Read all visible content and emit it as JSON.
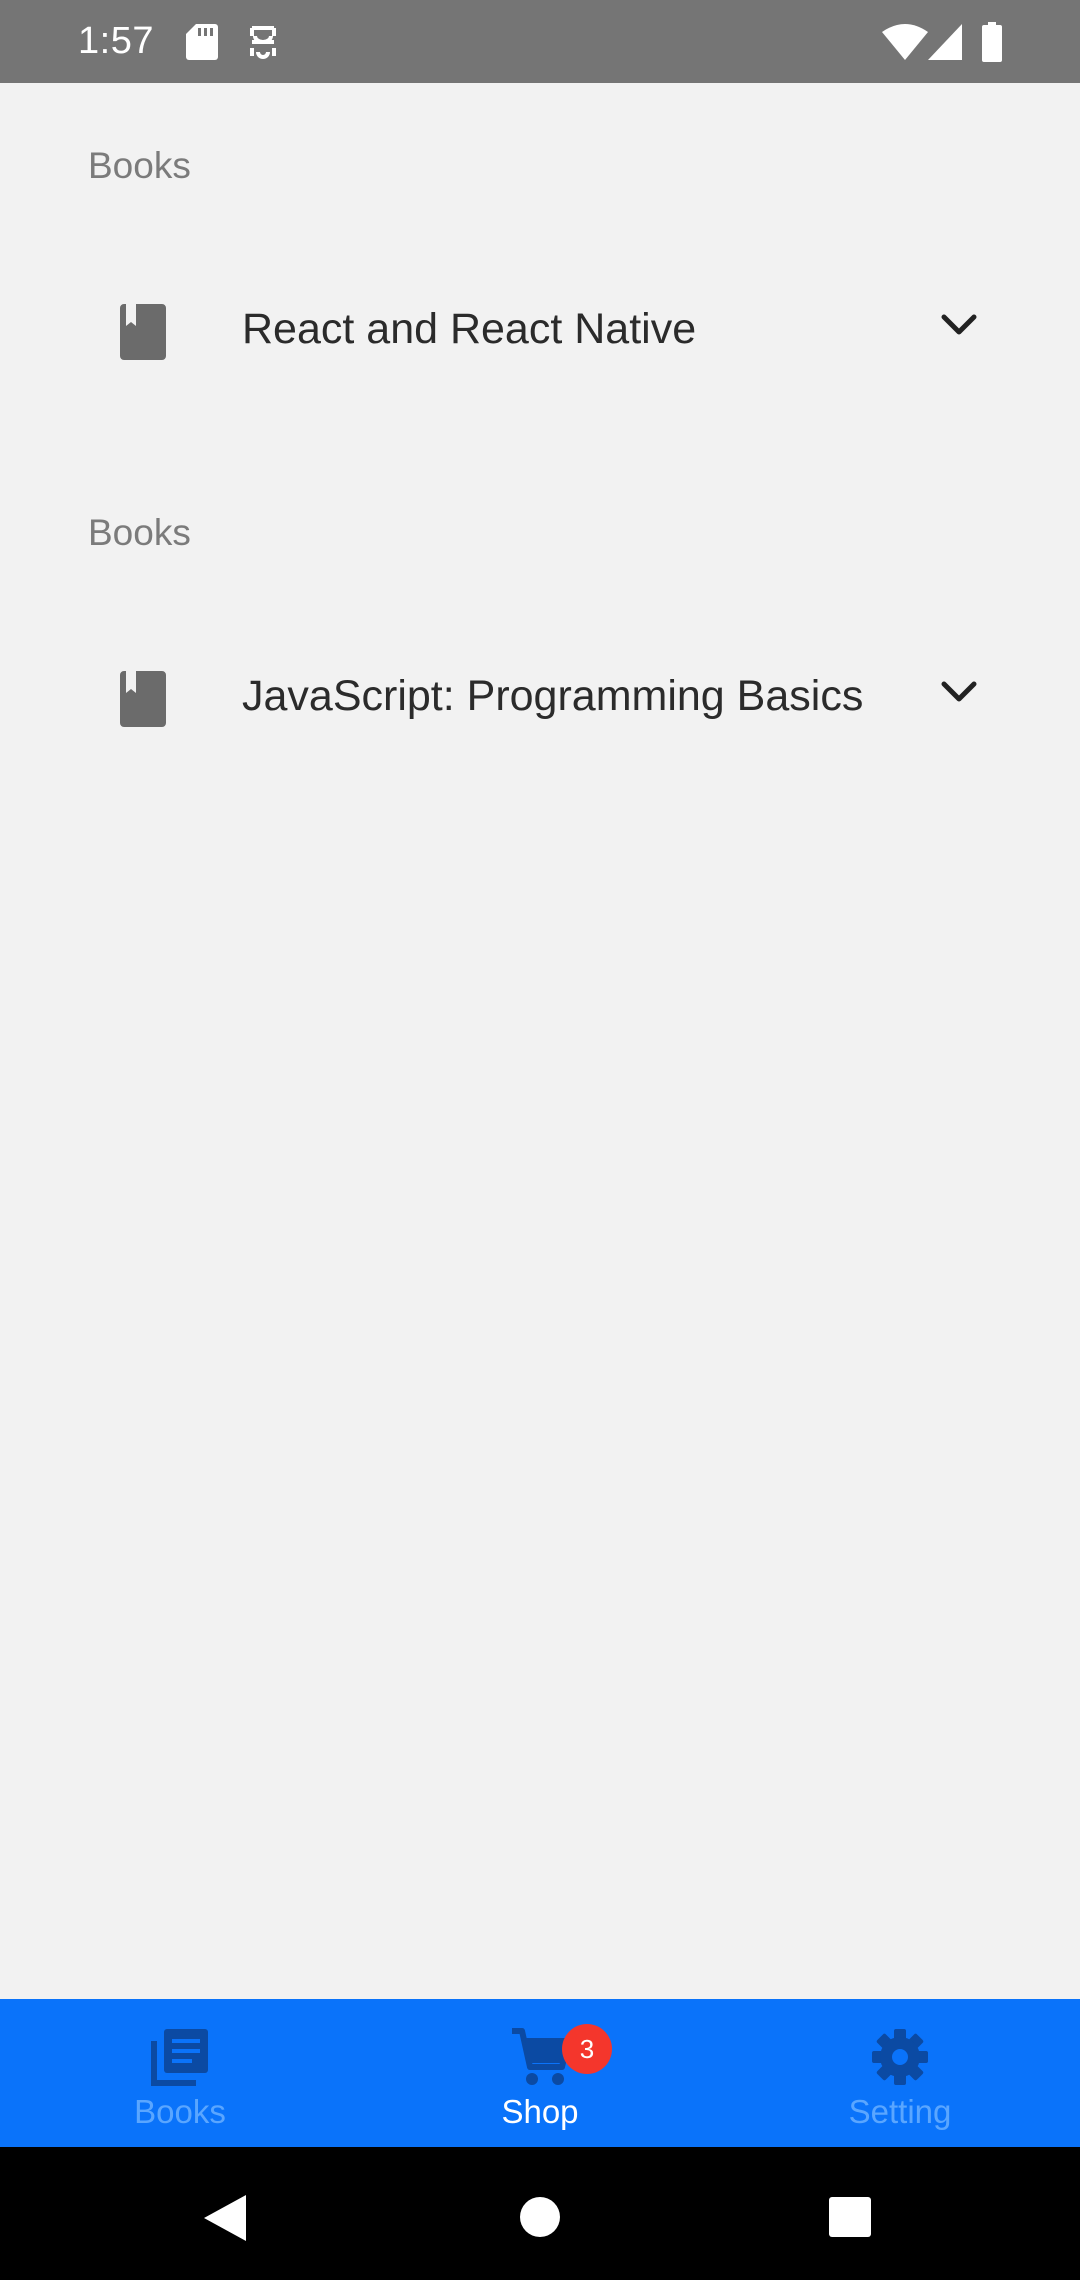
{
  "status_bar": {
    "time": "1:57",
    "icons": [
      "sd-card-icon",
      "debug-icon",
      "wifi-icon",
      "signal-icon",
      "battery-icon"
    ]
  },
  "sections": [
    {
      "header": "Books",
      "book": {
        "title": "React and React Native",
        "icon": "book-icon"
      }
    },
    {
      "header": "Books",
      "book": {
        "title": "JavaScript: Programming Basics",
        "icon": "book-icon"
      }
    }
  ],
  "tab_bar": {
    "tabs": [
      {
        "label": "Books",
        "icon": "library-books-icon",
        "active": false
      },
      {
        "label": "Shop",
        "icon": "cart-icon",
        "active": true
      },
      {
        "label": "Setting",
        "icon": "gear-icon",
        "active": false
      }
    ],
    "shop_badge": "3"
  },
  "colors": {
    "tab_bar_bg": "#0a73fa",
    "tab_icon_inactive": "#0b4aa3",
    "tab_label_inactive": "#5aa6ff",
    "tab_label_active": "#ffffff",
    "badge": "#f4362c",
    "status_bar": "#757575",
    "background": "#f2f2f2"
  },
  "nav_bar": {
    "buttons": [
      "back-icon",
      "home-icon",
      "recents-icon"
    ]
  }
}
